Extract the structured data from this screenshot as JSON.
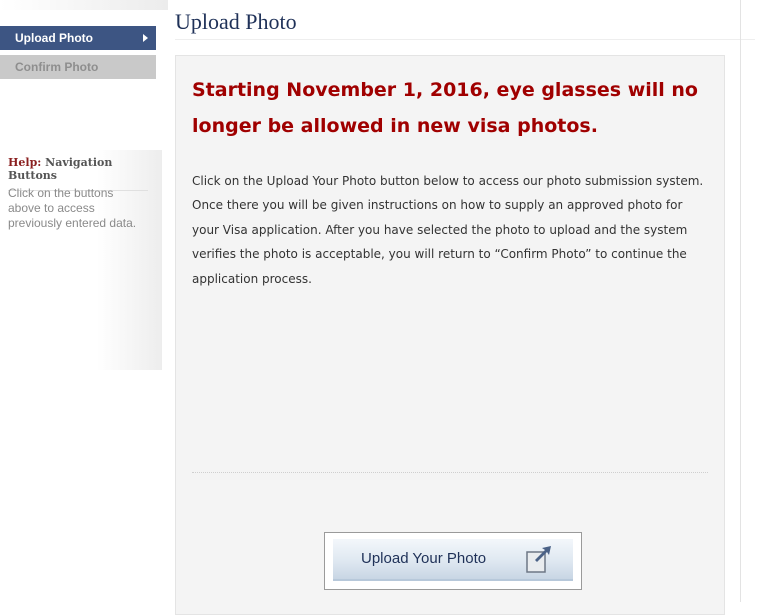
{
  "sidebar": {
    "items": [
      {
        "label": "Upload Photo",
        "state": "active"
      },
      {
        "label": "Confirm Photo",
        "state": "disabled"
      }
    ],
    "help": {
      "title_prefix": "Help:",
      "title": "Navigation Buttons",
      "text": "Click on the buttons above to access previously entered data."
    }
  },
  "main": {
    "title": "Upload Photo",
    "notice": "Starting November 1, 2016, eye glasses will no longer be allowed in new visa photos.",
    "instructions": "Click on the Upload Your Photo button below to access our photo submission system. Once there you will be given instructions on how to supply an approved photo for your Visa application. After you have selected the photo to upload and the system verifies the photo is acceptable, you will return to “Confirm Photo” to continue the application process.",
    "upload_button": {
      "label": "Upload Your Photo",
      "icon": "upload-icon"
    }
  },
  "colors": {
    "nav_active": "#3d5583",
    "nav_disabled": "#c9c9c9",
    "notice_red": "#a00000",
    "title_navy": "#1f3158"
  }
}
